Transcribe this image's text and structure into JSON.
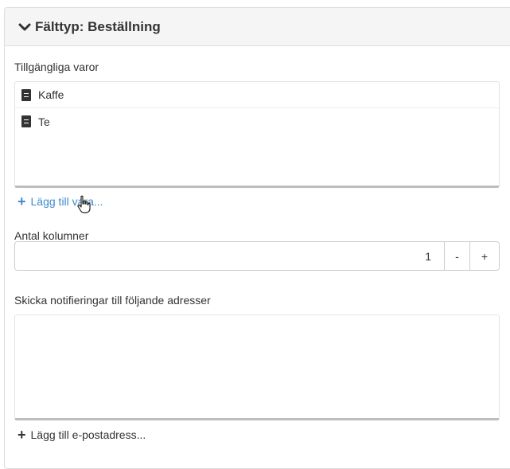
{
  "panel": {
    "title": "Fälttyp: Beställning",
    "chevron_icon": "chevron-down-icon"
  },
  "products": {
    "label": "Tillgängliga varor",
    "items": [
      {
        "label": "Kaffe",
        "icon": "document-icon"
      },
      {
        "label": "Te",
        "icon": "document-icon"
      }
    ],
    "add_label": "Lägg till vara...",
    "add_icon": "plus-icon"
  },
  "columns": {
    "label": "Antal kolumner",
    "value": "1",
    "decrement_label": "-",
    "increment_label": "+"
  },
  "notifications": {
    "label": "Skicka notifieringar till följande adresser",
    "add_label": "Lägg till e-postadress...",
    "add_icon": "plus-icon"
  },
  "colors": {
    "link": "#428bca",
    "text": "#333333",
    "heading_bg": "#f5f5f5"
  }
}
